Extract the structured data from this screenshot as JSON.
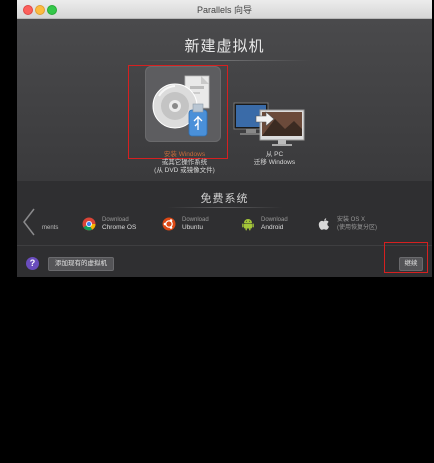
{
  "window": {
    "title": "Parallels 向导"
  },
  "header": {
    "title": "新建虚拟机"
  },
  "options": [
    {
      "line1": "安装 Windows",
      "line2": "或其它操作系统",
      "line3": "(从 DVD 或镜像文件)"
    },
    {
      "line1": "从 PC",
      "line2": "迁移 Windows"
    }
  ],
  "free": {
    "title": "免费系统",
    "partial_label": "ments",
    "items": [
      {
        "small": "Download",
        "name": "Chrome OS",
        "icon": "chrome-icon"
      },
      {
        "small": "Download",
        "name": "Ubuntu",
        "icon": "ubuntu-icon"
      },
      {
        "small": "Download",
        "name": "Android",
        "icon": "android-icon"
      },
      {
        "small": "安装 OS X",
        "name": "(使用恢复分区)",
        "icon": "apple-icon"
      }
    ]
  },
  "footer": {
    "help_label": "?",
    "add_existing_label": "添加现有的虚拟机",
    "continue_label": "继续"
  },
  "colors": {
    "highlight": "#d62020",
    "accent_orange": "#c86b3a"
  }
}
